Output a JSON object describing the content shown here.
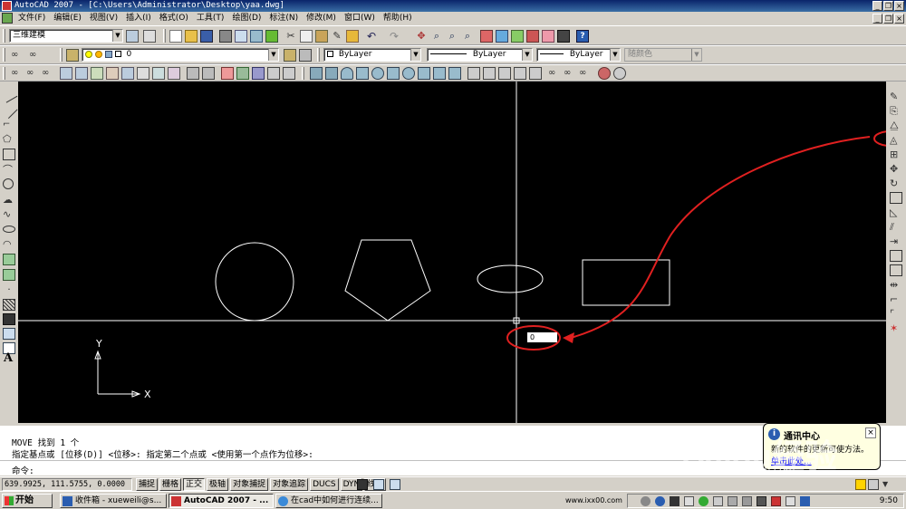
{
  "app": {
    "title": "AutoCAD 2007 - [C:\\Users\\Administrator\\Desktop\\yaa.dwg]"
  },
  "menu": {
    "items": [
      "文件(F)",
      "编辑(E)",
      "视图(V)",
      "插入(I)",
      "格式(O)",
      "工具(T)",
      "绘图(D)",
      "标注(N)",
      "修改(M)",
      "窗口(W)",
      "帮助(H)"
    ]
  },
  "toolbar": {
    "workspace": "三维建模",
    "layer": "0",
    "color": "ByLayer",
    "linetype": "ByLayer",
    "lineweight": "ByLayer",
    "plotstyle": "随颜色"
  },
  "canvas": {
    "coord_input_value": "0",
    "ucs_y_label": "Y",
    "ucs_x_label": "X"
  },
  "command": {
    "line1": "MOVE 找到 1 个",
    "line2": "指定基点或 [位移(D)] <位移>:  指定第二个点或 <使用第一个点作为位移>:",
    "prompt": "命令:"
  },
  "balloon": {
    "title": "通讯中心",
    "text": "新的软件的更新可使方法。",
    "link": "单击此处..."
  },
  "status": {
    "coords": "639.9925, 111.5755, 0.0000",
    "toggles": [
      {
        "label": "捕捉",
        "on": false
      },
      {
        "label": "栅格",
        "on": false
      },
      {
        "label": "正交",
        "on": true
      },
      {
        "label": "极轴",
        "on": false
      },
      {
        "label": "对象捕捉",
        "on": false
      },
      {
        "label": "对象追踪",
        "on": false
      },
      {
        "label": "DUCS",
        "on": false
      },
      {
        "label": "DYN",
        "on": false
      },
      {
        "label": "线宽",
        "on": false
      }
    ]
  },
  "taskbar": {
    "start": "开始",
    "tasks": [
      "收件箱 - xueweili@s...",
      "AutoCAD 2007 - ...",
      "在cad中如何进行连续..."
    ],
    "tray_url": "www.ixx00.com",
    "clock": "9:50"
  },
  "watermark": {
    "brand": "Baidu经验",
    "sub": "jingyan.baidu.com"
  },
  "colors": {
    "canvas_bg": "#000000",
    "annotation": "#e02020",
    "titlebar": "#0a246a"
  }
}
